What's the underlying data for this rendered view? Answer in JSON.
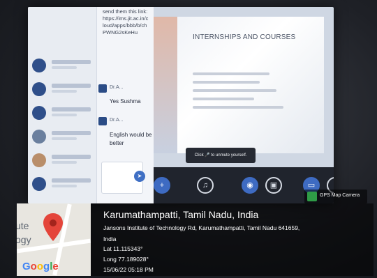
{
  "chat": {
    "link_message": "send them this link: https://ims.jit.ac.in/cloud/apps/bbb/b/chPWNG2sKeHu",
    "sender_1": "Dr.A...",
    "message_1": "Yes Sushma",
    "sender_2": "Dr.A...",
    "message_2": "English would be better",
    "send_icon": "send-icon"
  },
  "slide": {
    "title": "INTERNSHIPS AND COURSES"
  },
  "meeting": {
    "unmute_prompt": "Click 🎤 to unmute yourself."
  },
  "toolbar": {
    "icons": [
      "plus-icon",
      "microphone-icon",
      "camera-icon",
      "screen-share-icon",
      "display-icon",
      "more-icon"
    ]
  },
  "gps": {
    "app_name": "GPS Map Camera",
    "location_title": "Karumathampatti, Tamil Nadu, India",
    "address_line_1": "Jansons Institute of Technology Rd, Karumathampatti, Tamil Nadu 641659,",
    "address_line_2": "India",
    "lat": "Lat 11.115343°",
    "long": "Long 77.189028°",
    "datetime": "15/06/22 05:18 PM",
    "map_brand": "Google",
    "map_label_1": "ute",
    "map_label_2": "ogy"
  },
  "colors": {
    "accent": "#3e6bc2",
    "pin": "#e4453a"
  }
}
